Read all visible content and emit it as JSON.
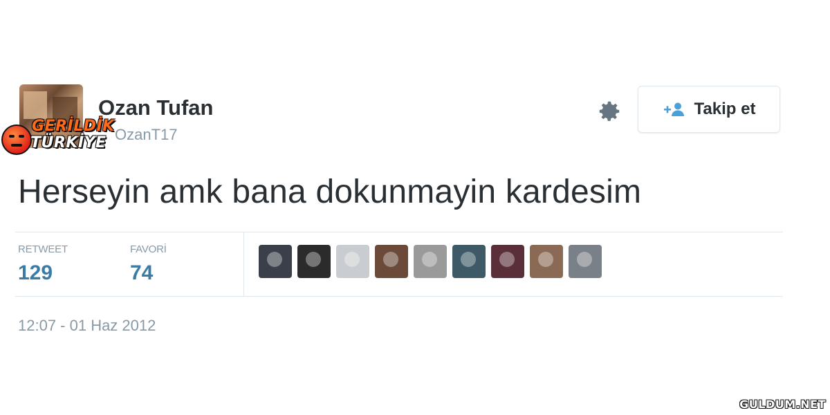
{
  "profile": {
    "name": "Ozan Tufan",
    "handle": "OzanT17"
  },
  "actions": {
    "follow_label": "Takip et"
  },
  "tweet": {
    "text": "Herseyin amk bana dokunmayin kardesim",
    "timestamp": "12:07 - 01 Haz 2012"
  },
  "stats": {
    "retweet_label": "RETWEET",
    "retweet_count": "129",
    "favorite_label": "FAVORİ",
    "favorite_count": "74"
  },
  "favoriters": [
    {
      "avatar_color": "#3a3f4a"
    },
    {
      "avatar_color": "#2b2b2b"
    },
    {
      "avatar_color": "#c9ccd0"
    },
    {
      "avatar_color": "#6b4a3a"
    },
    {
      "avatar_color": "#9a9a9a"
    },
    {
      "avatar_color": "#3d5a66"
    },
    {
      "avatar_color": "#5a2f3a"
    },
    {
      "avatar_color": "#8a6a55"
    },
    {
      "avatar_color": "#7a8088"
    }
  ],
  "watermark": {
    "line1": "GERİLDİK",
    "line2": "TÜRKİYE",
    "site": "GULDUM.NET"
  },
  "colors": {
    "stat_value": "#3a7ca5",
    "muted": "#8899a6",
    "text": "#292f33"
  }
}
